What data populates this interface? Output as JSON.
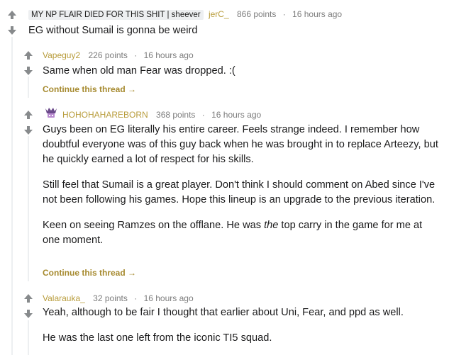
{
  "comments": [
    {
      "flair": "MY NP FLAIR DIED FOR THIS SHIT | sheever",
      "author": "jerC_",
      "points": "866 points",
      "time": "16 hours ago",
      "body": [
        "EG without Sumail is gonna be weird"
      ]
    },
    {
      "author": "Vapeguy2",
      "points": "226 points",
      "time": "16 hours ago",
      "body": [
        "Same when old man Fear was dropped. :("
      ],
      "continue": "Continue this thread"
    },
    {
      "author": "HOHOHAHAREBORN",
      "points": "368 points",
      "time": "16 hours ago",
      "body": [
        "Guys been on EG literally his entire career. Feels strange indeed. I remember how doubtful everyone was of this guy back when he was brought in to replace Arteezy, but he quickly earned a lot of respect for his skills.",
        "Still feel that Sumail is a great player. Don't think I should comment on Abed since I've not been following his games. Hope this lineup is an upgrade to the previous iteration."
      ],
      "body3_before": "Keen on seeing Ramzes on the offlane. He was ",
      "body3_em": "the",
      "body3_after": " top carry in the game for me at one moment.",
      "continue": "Continue this thread"
    },
    {
      "author": "Valarauka_",
      "points": "32 points",
      "time": "16 hours ago",
      "body": [
        "Yeah, although to be fair I thought that earlier about Uni, Fear, and ppd as well.",
        "He was the last one left from the iconic TI5 squad."
      ]
    }
  ],
  "separator": "·",
  "continue_arrow": "→",
  "colors": {
    "author_gold": "#b89c3b",
    "continue": "#a68a2f",
    "thread_line": "#edeff1"
  }
}
